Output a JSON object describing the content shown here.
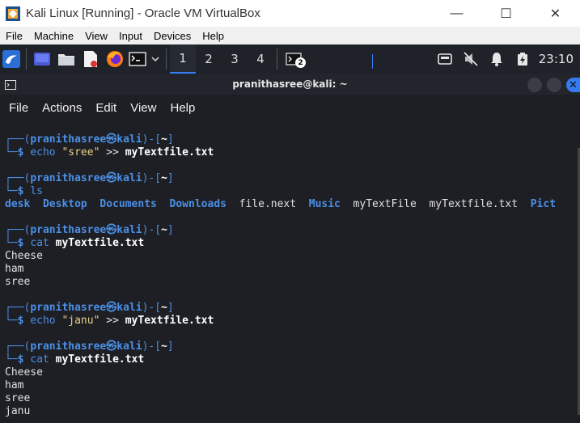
{
  "window": {
    "title": "Kali Linux [Running] - Oracle VM VirtualBox",
    "minimize": "—",
    "maximize": "☐",
    "close": "✕"
  },
  "vbox_menu": [
    "File",
    "Machine",
    "View",
    "Input",
    "Devices",
    "Help"
  ],
  "panel": {
    "workspaces": [
      "1",
      "2",
      "3",
      "4"
    ],
    "active_workspace": "1",
    "task_badge": "2",
    "clock": "23:10"
  },
  "terminal": {
    "title": "pranithasree@kali: ~",
    "menu": [
      "File",
      "Actions",
      "Edit",
      "View",
      "Help"
    ],
    "prompt": {
      "top_left": "┌──(",
      "user": "pranithasree",
      "at": "㉿",
      "host": "kali",
      "mid": ")-[",
      "dir": "~",
      "end": "]",
      "bottom": "└─",
      "dollar": "$"
    },
    "commands": [
      {
        "cmd": "echo",
        "arg": "\"sree\"",
        "op": ">>",
        "file": "myTextfile.txt"
      },
      {
        "cmd": "ls"
      },
      {
        "cmd": "cat",
        "file": "myTextfile.txt"
      },
      {
        "cmd": "echo",
        "arg": "\"janu\"",
        "op": ">>",
        "file": "myTextfile.txt"
      },
      {
        "cmd": "cat",
        "file": "myTextfile.txt"
      }
    ],
    "ls_output": [
      "desk",
      "Desktop",
      "Documents",
      "Downloads",
      "file.next",
      "Music",
      "myTextFile",
      "myTextfile.txt",
      "Pict"
    ],
    "cat_output_1": [
      "Cheese",
      "ham",
      "sree"
    ],
    "cat_output_2": [
      "Cheese",
      "ham",
      "sree",
      "janu"
    ]
  }
}
